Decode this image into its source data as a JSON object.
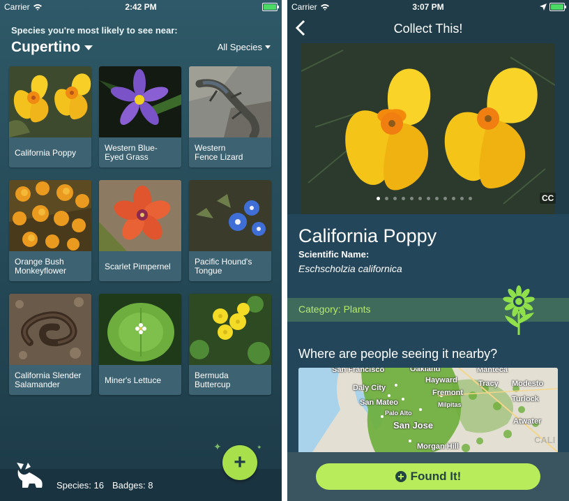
{
  "left_screen": {
    "status": {
      "carrier": "Carrier",
      "time": "2:42 PM"
    },
    "near_label": "Species you're most likely to see near:",
    "location": "Cupertino",
    "filter": "All Species",
    "species": [
      {
        "name": "California Poppy"
      },
      {
        "name": "Western Blue-\nEyed Grass"
      },
      {
        "name": "Western\nFence Lizard"
      },
      {
        "name": "Orange Bush\nMonkeyflower"
      },
      {
        "name": "Scarlet Pimpernel"
      },
      {
        "name": "Pacific Hound's\nTongue"
      },
      {
        "name": "California Slender\nSalamander"
      },
      {
        "name": "Miner's Lettuce"
      },
      {
        "name": "Bermuda\nButtercup"
      }
    ],
    "stats": {
      "species": "Species: 16",
      "badges": "Badges: 8"
    },
    "fab_label": "+"
  },
  "right_screen": {
    "status": {
      "carrier": "Carrier",
      "time": "3:07 PM"
    },
    "nav_title": "Collect This!",
    "cc_label": "CC",
    "species_title": "California Poppy",
    "scientific_label": "Scientific Name:",
    "scientific_name": "Eschscholzia californica",
    "category": "Category: Plants",
    "where_heading": "Where are people seeing it nearby?",
    "map_labels": [
      "San Francisco",
      "Oakland",
      "Manteca",
      "Hayward",
      "Daly City",
      "Tracy",
      "Modesto",
      "Fremont",
      "San Mateo",
      "Milpitas",
      "Turlock",
      "Palo Alto",
      "San Jose",
      "Atwater",
      "Morgan Hill",
      "CALI"
    ],
    "found_button": "Found It!"
  },
  "colors": {
    "accent_green": "#a7e04a",
    "found_button": "#b8ec5a",
    "category_text": "#b6ea6f",
    "battery": "#4cd964"
  }
}
